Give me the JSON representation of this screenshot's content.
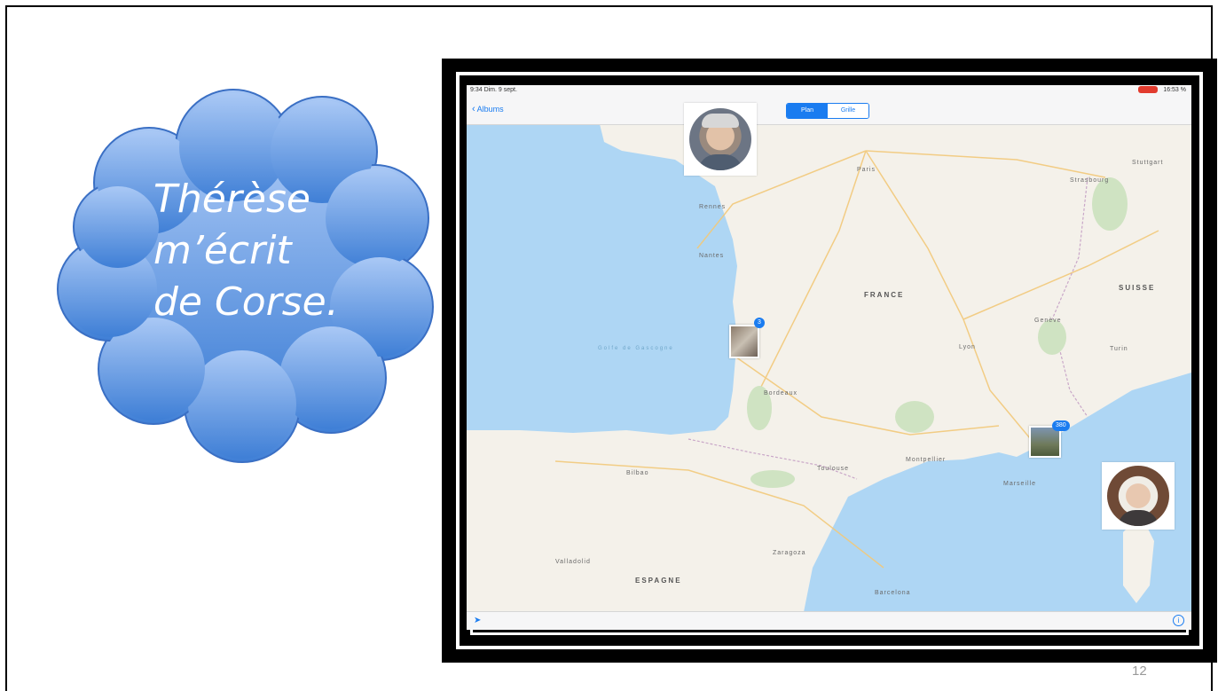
{
  "cloud": {
    "line1": "Thérèse",
    "line2": "m’écrit",
    "line3": "de Corse."
  },
  "ipad": {
    "status_left": "9:34  Dim. 9 sept.",
    "status_right": "16:53 %",
    "back_label": "Albums",
    "segment_on": "Plan",
    "segment_off": "Grille",
    "map_labels": {
      "france": "FRANCE",
      "espagne": "ESPAGNE",
      "suisse": "SUISSE",
      "golfe": "Golfe de Gascogne",
      "paris": "Paris",
      "rennes": "Rennes",
      "nantes": "Nantes",
      "bordeaux": "Bordeaux",
      "lyon": "Lyon",
      "toulouse": "Toulouse",
      "montpellier": "Montpellier",
      "marseille": "Marseille",
      "strasbourg": "Strasbourg",
      "stuttgart": "Stuttgart",
      "zaragoza": "Zaragoza",
      "barcelona": "Barcelona",
      "valladolid": "Valladolid",
      "bilbao": "Bilbao",
      "geneve": "Genève",
      "turin": "Turin"
    },
    "badge_west": "3",
    "badge_east": "380"
  },
  "colors": {
    "cloud_top": "#a9c8f5",
    "cloud_bottom": "#3f7fd6",
    "sea": "#aed6f4",
    "land": "#f4f1ea",
    "ios_blue": "#1a7cf0"
  },
  "page_number": "12"
}
